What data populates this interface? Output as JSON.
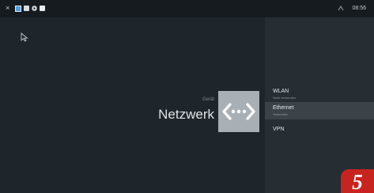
{
  "statusbar": {
    "close_glyph": "×",
    "icons": [
      "app-icon",
      "photo-icon",
      "play-icon",
      "note-icon"
    ],
    "ethernet_icon": "ethernet-icon",
    "time": "08:56"
  },
  "main": {
    "category": "Gerät",
    "title": "Netzwerk",
    "hero_icon": "network-arrows-icon"
  },
  "panel": {
    "items": [
      {
        "label": "WLAN",
        "sublabel": "Nicht verbunden",
        "selected": false
      },
      {
        "label": "Ethernet",
        "sublabel": "Verbunden",
        "selected": true
      },
      {
        "label": "VPN",
        "sublabel": "",
        "selected": false
      }
    ]
  },
  "badge": {
    "number": "5"
  },
  "colors": {
    "background": "#1f262b",
    "panel": "#262e34",
    "selected": "#3b4349",
    "hero_tile": "#a8b0b5",
    "badge": "#c8241f"
  }
}
